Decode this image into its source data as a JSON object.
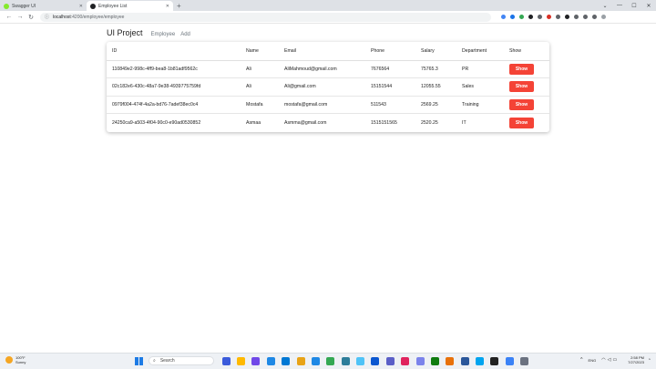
{
  "browser": {
    "tabs": [
      {
        "title": "Swagger UI",
        "icon": "swagger-icon",
        "color": "#85ea2d",
        "active": false
      },
      {
        "title": "Employee List",
        "icon": "angular-app-icon",
        "color": "#202124",
        "active": true
      }
    ],
    "url_host": "localhost",
    "url_path": ":4200/employee/employee",
    "extension_colors": [
      "#4285f4",
      "#1a73e8",
      "#34a853",
      "#202124",
      "#5f6368",
      "#d93025",
      "#5f6368",
      "#202124",
      "#5f6368",
      "#5f6368",
      "#5f6368",
      "#9aa0a6"
    ]
  },
  "app": {
    "brand": "UI Project",
    "nav": [
      "Employee",
      "Add"
    ]
  },
  "table": {
    "columns": [
      "ID",
      "Name",
      "Email",
      "Phone",
      "Salary",
      "Department",
      "Show"
    ],
    "rows": [
      {
        "id": "110849e2-998c-4ff9-bea8-1b81adf9562c",
        "name": "Ali",
        "email": "AliMahmoud@gmail.com",
        "phone": "7676564",
        "salary": "75765.3",
        "department": "PR",
        "button": "Show"
      },
      {
        "id": "02c182e6-430c-48a7-9e38-4939775759fd",
        "name": "Ali",
        "email": "Ali@gmail.com",
        "phone": "15151544",
        "salary": "12055.55",
        "department": "Sales",
        "button": "Show"
      },
      {
        "id": "0979f004-474f-4a2a-bd76-7adef38ec0c4",
        "name": "Mostafa",
        "email": "mostafa@gmail.com",
        "phone": "511543",
        "salary": "2569.25",
        "department": "Training",
        "button": "Show"
      },
      {
        "id": "24250ca9-a503-4f04-90c0-e90ad0530852",
        "name": "Asmaa",
        "email": "Asmma@gmail.com",
        "phone": "1515151565",
        "salary": "2520.25",
        "department": "IT",
        "button": "Show"
      }
    ],
    "button_color": "#f44336"
  },
  "taskbar": {
    "weather_temp": "100°F",
    "weather_desc": "Sunny",
    "search_placeholder": "Search",
    "app_colors": [
      "#3b5bdb",
      "#ffb900",
      "#7048e8",
      "#1e88e5",
      "#0078d4",
      "#e8a317",
      "#1e88e5",
      "#34a853",
      "#2d7d9a",
      "#4fc3f7",
      "#0b57d0",
      "#5b5fc7",
      "#e0245e",
      "#7b83eb",
      "#107c10",
      "#e8710a",
      "#2b579a",
      "#00a4ef",
      "#222222",
      "#3b82f6",
      "#6b7280"
    ],
    "language": "ENG",
    "time": "2:58 PM",
    "date": "7/27/2023"
  }
}
